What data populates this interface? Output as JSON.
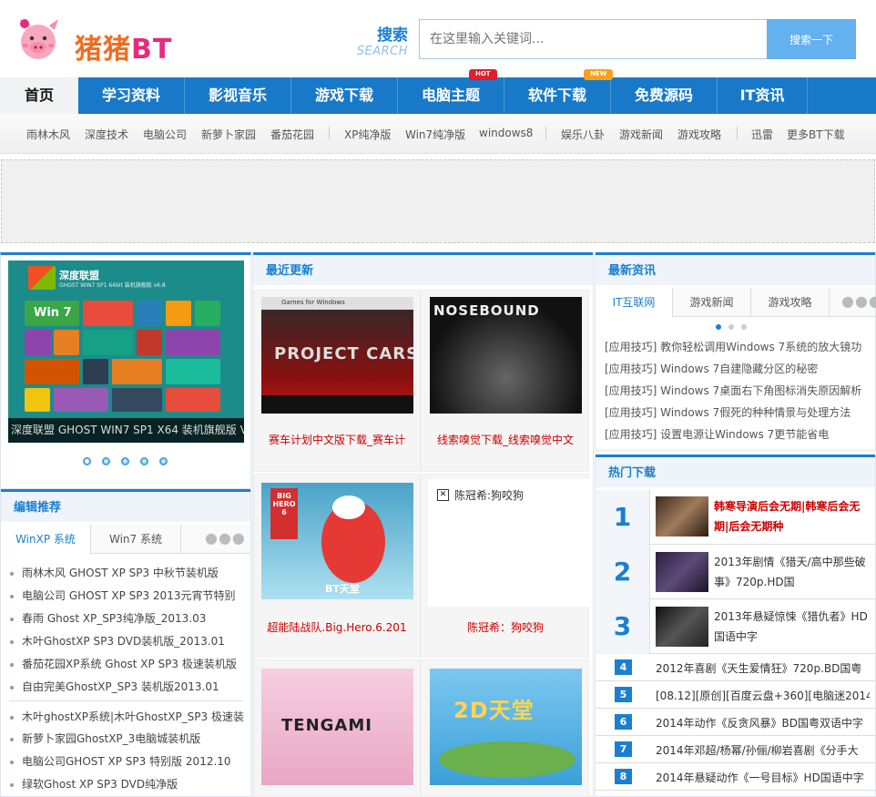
{
  "site": {
    "logo_text_a": "猪猪",
    "logo_text_b": "BT",
    "search_label_cn": "搜索",
    "search_label_en": "SEARCH",
    "search_placeholder": "在这里输入关键词...",
    "search_button": "搜索一下"
  },
  "nav": {
    "items": [
      {
        "label": "首页"
      },
      {
        "label": "学习资料"
      },
      {
        "label": "影视音乐"
      },
      {
        "label": "游戏下载"
      },
      {
        "label": "电脑主题",
        "badge": "HOT"
      },
      {
        "label": "软件下载",
        "badge": "NEW"
      },
      {
        "label": "免费源码"
      },
      {
        "label": "IT资讯"
      }
    ]
  },
  "subnav": {
    "links": [
      "雨林木风",
      "深度技术",
      "电脑公司",
      "新萝卜家园",
      "番茄花园",
      "XP纯净版",
      "Win7纯净版",
      "windows8",
      "娱乐八卦",
      "游戏新闻",
      "游戏攻略",
      "迅雷",
      "更多BT下载"
    ]
  },
  "slider": {
    "brand": "深度联盟",
    "sub": "GHOST WIN7 SP1 64bit 装机旗舰版 v6.8",
    "win7": "Win 7",
    "caption": "深度联盟 GHOST WIN7 SP1 X64 装机旗舰版 V"
  },
  "editor": {
    "title": "编辑推荐",
    "tabs": [
      "WinXP 系统",
      "Win7 系统"
    ],
    "list_a": [
      "雨林木风 GHOST XP SP3 中秋节装机版",
      "电脑公司 GHOST XP SP3 2013元宵节特别",
      "春雨 Ghost XP_SP3纯净版_2013.03",
      "木叶GhostXP SP3 DVD装机版_2013.01",
      "番茄花园XP系统 Ghost XP SP3 极速装机版",
      "自由完美GhostXP_SP3 装机版2013.01"
    ],
    "list_b": [
      "木叶ghostXP系统|木叶GhostXP_SP3 极速装",
      "新萝卜家园GhostXP_3电脑城装机版",
      "电脑公司GHOST XP SP3 特别版 2012.10",
      "绿软Ghost XP SP3 DVD纯净版"
    ]
  },
  "latest": {
    "title": "最近更新",
    "games": [
      {
        "caption": "赛车计划中文版下载_赛车计",
        "img_title": "PROJECT CARS",
        "img_top": "Games for Windows"
      },
      {
        "caption": "线索嗅觉下载_线索嗅觉中文",
        "img_title": "NOSEBOUND"
      },
      {
        "caption": "超能陆战队.Big.Hero.6.201",
        "img_title": "BIG HERO 6",
        "img_logo": "BT天堂"
      },
      {
        "caption": "陈冠希：狗咬狗",
        "broken_alt": "陈冠希:狗咬狗"
      },
      {
        "caption": "",
        "img_title": "TENGAMI"
      },
      {
        "caption": "",
        "img_title": "2D天堂"
      }
    ]
  },
  "news": {
    "title": "最新资讯",
    "tabs": [
      "IT互联网",
      "游戏新闻",
      "游戏攻略"
    ],
    "items": [
      "[应用技巧] 教你轻松调用Windows 7系统的放大镜功",
      "[应用技巧] Windows 7自建隐藏分区的秘密",
      "[应用技巧] Windows 7桌面右下角图标消失原因解析",
      "[应用技巧] Windows 7假死的种种情景与处理方法",
      "[应用技巧] 设置电源让Windows 7更节能省电"
    ]
  },
  "hot": {
    "title": "热门下载",
    "top": [
      {
        "rank": "1",
        "title": "韩寒导演后会无期|韩寒后会无期|后会无期种"
      },
      {
        "rank": "2",
        "title": "2013年剧情《猎天/高中那些破事》720p.HD国"
      },
      {
        "rank": "3",
        "title": "2013年悬疑惊悚《猎仇者》HD国语中字"
      }
    ],
    "rest": [
      {
        "rank": "4",
        "title": "2012年喜剧《天生爱情狂》720p.BD国粤"
      },
      {
        "rank": "5",
        "title": "[08.12][原创][百度云盘+360][电脑迷2014"
      },
      {
        "rank": "6",
        "title": "2014年动作《反贪风暴》BD国粤双语中字"
      },
      {
        "rank": "7",
        "title": "2014年邓超/杨幂/孙俪/柳岩喜剧《分手大"
      },
      {
        "rank": "8",
        "title": "2014年悬疑动作《一号目标》HD国语中字"
      }
    ]
  },
  "colors": {
    "accent": "#1979c9",
    "link_red": "#cc0000",
    "hot_badge": "#e21d2d",
    "new_badge": "#f9a01b"
  }
}
